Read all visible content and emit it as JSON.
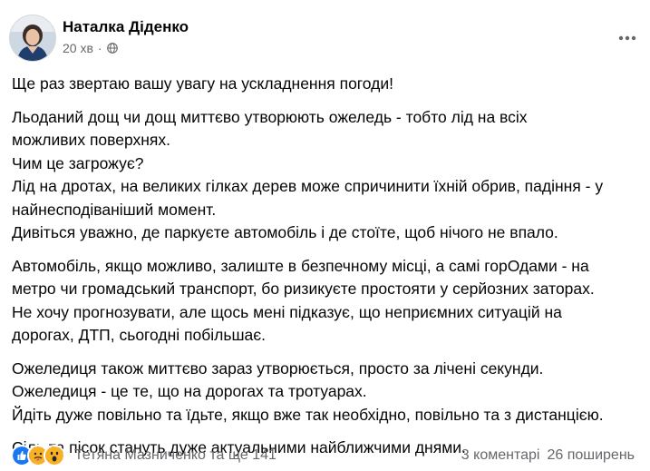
{
  "post": {
    "author": "Наталка Діденко",
    "time": "20 хв",
    "audience_icon": "globe-icon",
    "more_icon": "more-horizontal-icon",
    "paragraphs": [
      [
        "Ще раз звертаю вашу увагу на ускладнення погоди!"
      ],
      [
        "Льоданий дощ чи дощ миттєво утворюють ожеледь - тобто лід на всіх",
        "можливих поверхнях.",
        "Чим це загрожує?",
        "Лід на дротах, на великих гілках дерев може спричинити їхній обрив, падіння - у",
        "найнесподіванiший момент.",
        "Дивіться уважно, де паркуєте автомобіль і де стоїте, щоб нічого не впало."
      ],
      [
        "Автомобіль, якщо можливо, залиште в безпечному місці, а самі горОдами - на",
        "метро чи громадський транспорт, бо ризикуєте простояти у серйозних заторах.",
        "Не хочу прогнозувати, але щось мені підказує, що неприємних ситуацій на",
        "дорогах, ДТП, сьогодні побільшає."
      ],
      [
        "Ожеледиця також миттєво зараз утворюється, просто за лічені секунди.",
        "Ожеледиця - це те, що на дорогах та тротуарах.",
        "Йдіть дуже повільно та їдьте, якщо вже так необхідно, повільно та з дистанцією."
      ],
      [
        "Сіль та пісок стануть дуже актуальними найближчими днями."
      ]
    ]
  },
  "footer": {
    "reaction_icons": [
      "like-icon",
      "care-icon",
      "wow-icon"
    ],
    "reactors": "Тетяна Мазниченко та ще 141",
    "comments": "3 коментарі",
    "shares": "26 поширень"
  },
  "colors": {
    "text": "#050505",
    "secondary": "#65676b",
    "like_blue": "#1877f2",
    "care_yellow": "#f7b125"
  }
}
